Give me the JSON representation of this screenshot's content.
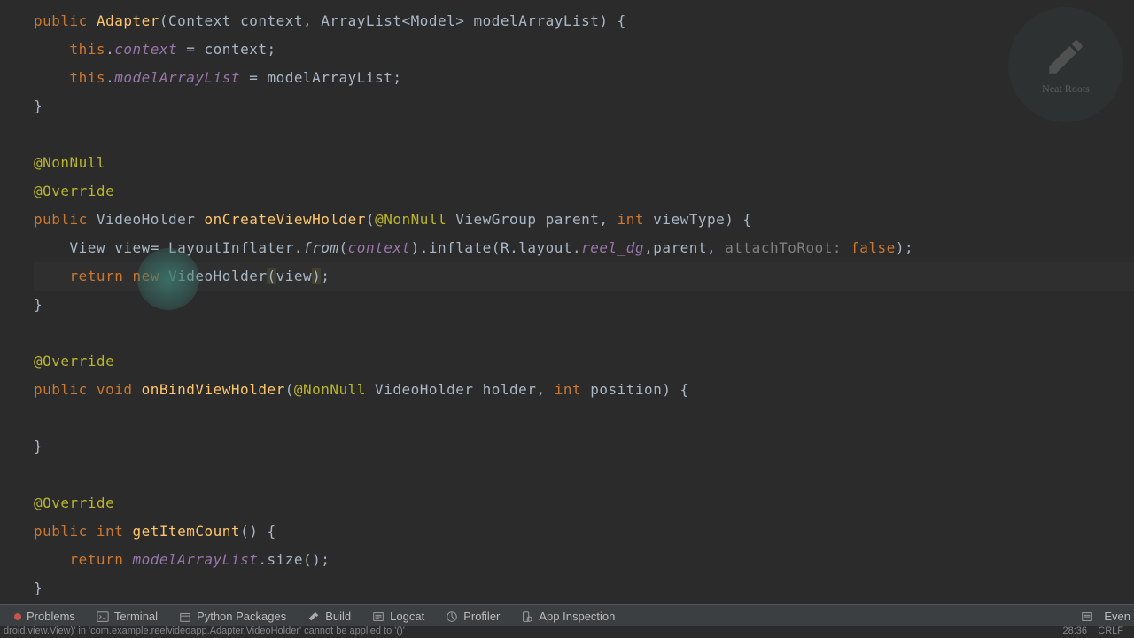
{
  "code": {
    "l1_public": "public",
    "l1_adapter": "Adapter",
    "l1_sig": "(Context context, ArrayList<Model> modelArrayList) {",
    "l2_this": "this",
    "l2_dot": ".",
    "l2_field": "context",
    "l2_eq": " = context;",
    "l3_this": "this",
    "l3_dot": ".",
    "l3_field": "modelArrayList",
    "l3_eq": " = modelArrayList;",
    "l4": "}",
    "l5_anno": "@NonNull",
    "l6_anno": "@Override",
    "l7_public": "public",
    "l7_type": " VideoHolder ",
    "l7_method": "onCreateViewHolder",
    "l7_open": "(",
    "l7_anno": "@NonNull",
    "l7_rest": " ViewGroup parent, ",
    "l7_int": "int",
    "l7_vt": " viewType) {",
    "l8_view": "    View ",
    "l8_var": "view",
    "l8_eq": "= LayoutInflater.",
    "l8_from": "from",
    "l8_open": "(",
    "l8_ctx": "context",
    "l8_close": ").inflate(R.layout.",
    "l8_reel": "reel_dg",
    "l8_comma": ",parent, ",
    "l8_hint": "attachToRoot:",
    "l8_false": " false",
    "l8_end": ");",
    "l9_return": "    return ",
    "l9_new": "new",
    "l9_vh": " VideoHolder",
    "l9_open": "(",
    "l9_view": "view",
    "l9_close": ")",
    "l9_end": ";",
    "l10": "}",
    "l11_anno": "@Override",
    "l12_public": "public",
    "l12_void": " void ",
    "l12_method": "onBindViewHolder",
    "l12_open": "(",
    "l12_anno": "@NonNull",
    "l12_rest": " VideoHolder holder, ",
    "l12_int": "int",
    "l12_pos": " position) {",
    "l13": "}",
    "l14_anno": "@Override",
    "l15_public": "public",
    "l15_int": " int ",
    "l15_method": "getItemCount",
    "l15_rest": "() {",
    "l16_return": "    return ",
    "l16_field": "modelArrayList",
    "l16_rest": ".size();",
    "l17": "}"
  },
  "toolbar": {
    "problems": "Problems",
    "terminal": "Terminal",
    "python": "Python Packages",
    "build": "Build",
    "logcat": "Logcat",
    "profiler": "Profiler",
    "inspection": "App Inspection",
    "event": "Even"
  },
  "status": {
    "line_col": "28:36",
    "encoding": "CRLF"
  },
  "error_msg": "droid.view.View)' in 'com.example.reelvideoapp.Adapter.VideoHolder' cannot be applied to '()'",
  "watermark": "Neat Roots"
}
